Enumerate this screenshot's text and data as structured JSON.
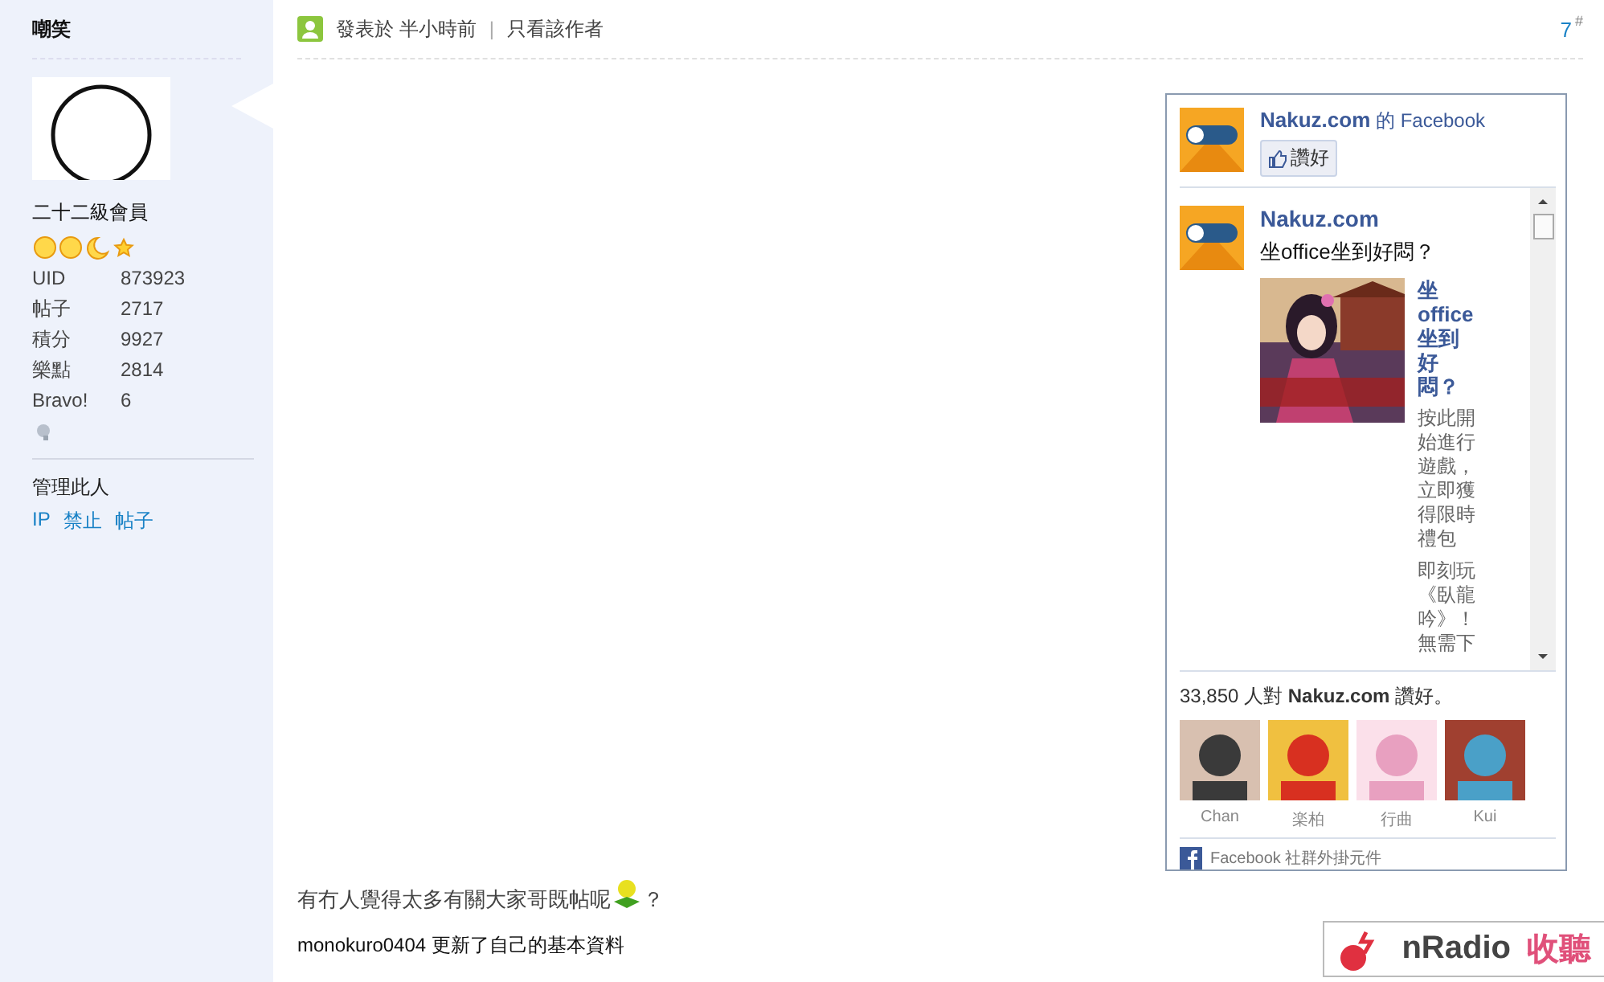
{
  "sidebar": {
    "username": "嘲笑",
    "rank": "二十二級會員",
    "stats": [
      {
        "label": "UID",
        "value": "873923"
      },
      {
        "label": "帖子",
        "value": "2717"
      },
      {
        "label": "積分",
        "value": "9927"
      },
      {
        "label": "樂點",
        "value": "2814"
      },
      {
        "label": "Bravo!",
        "value": "6"
      }
    ],
    "manage_label": "管理此人",
    "manage_links": [
      "IP",
      "禁止",
      "帖子"
    ]
  },
  "post": {
    "meta": "發表於 半小時前",
    "separator": "|",
    "author_filter": "只看該作者",
    "number": "7",
    "number_mark": "#",
    "facebook": {
      "page_name": "Nakuz.com",
      "title_suffix": "的 Facebook",
      "like_button": "讚好",
      "feed": {
        "author": "Nakuz.com",
        "message": "坐office坐到好悶？",
        "link_title": "坐office坐到好悶？",
        "description": "按此開始進行遊戲，立即獲得限時禮包",
        "description_2": "即刻玩《臥龍吟》！無需下"
      },
      "summary": "33,850 人對 **Nakuz.com** 讚好。",
      "fans": [
        "Chan",
        "楽柏",
        "行曲",
        "Kui"
      ],
      "footer": "Facebook 社群外掛元件"
    },
    "body": "有冇人覺得太多有關大家哥既帖呢",
    "body_end": "？",
    "activity": "monokuro0404 更新了自己的基本資料",
    "banner": {
      "brand": "nRadio",
      "tagline": "收聽"
    }
  }
}
